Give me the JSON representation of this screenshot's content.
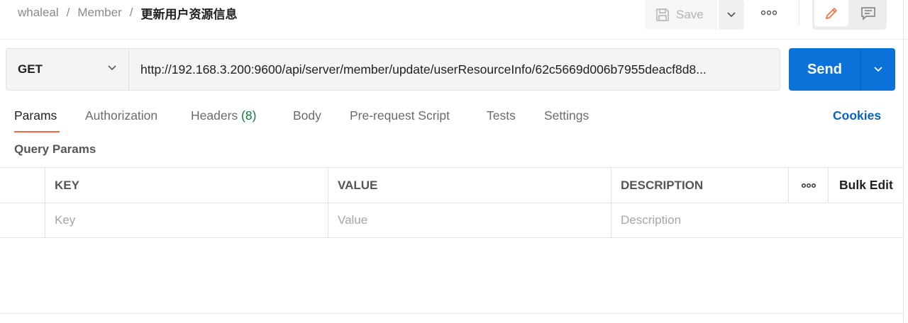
{
  "breadcrumb": {
    "workspace": "whaleal",
    "collection": "Member",
    "separator": "/",
    "request_name": "更新用户资源信息"
  },
  "toolbar": {
    "save_label": "Save",
    "save_icon": "save-disk-icon",
    "more_icon": "more-dots-icon",
    "edit_icon": "pencil-icon",
    "comment_icon": "comment-icon"
  },
  "request": {
    "method": "GET",
    "url": "http://192.168.3.200:9600/api/server/member/update/userResourceInfo/62c5669d006b7955deacf8d8...",
    "send_label": "Send"
  },
  "tabs": [
    {
      "label": "Params",
      "active": true
    },
    {
      "label": "Authorization"
    },
    {
      "label": "Headers",
      "count": "(8)"
    },
    {
      "label": "Body"
    },
    {
      "label": "Pre-request Script"
    },
    {
      "label": "Tests"
    },
    {
      "label": "Settings"
    }
  ],
  "cookies_label": "Cookies",
  "params": {
    "section_title": "Query Params",
    "columns": {
      "key": "KEY",
      "value": "VALUE",
      "description": "DESCRIPTION"
    },
    "bulk_edit_label": "Bulk Edit",
    "placeholders": {
      "key": "Key",
      "value": "Value",
      "description": "Description"
    }
  },
  "colors": {
    "accent": "#f26b3a",
    "send_button": "#0b72d9",
    "link": "#0b62c4",
    "header_count": "#0f7b3b"
  }
}
